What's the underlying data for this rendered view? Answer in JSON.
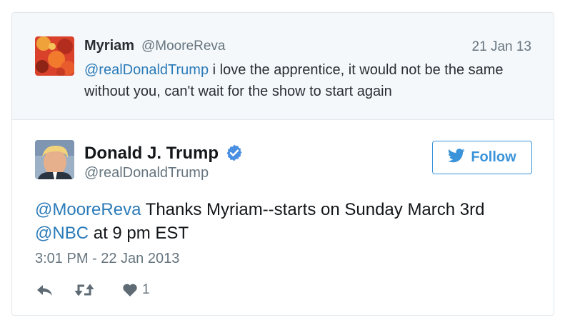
{
  "parent_tweet": {
    "name": "Myriam",
    "handle": "@MooreReva",
    "date": "21 Jan 13",
    "mention": "@realDonaldTrump",
    "text": " i love the apprentice, it would not be the same without you, can't wait for the show to start again"
  },
  "tweet": {
    "name": "Donald J. Trump",
    "handle": "@realDonaldTrump",
    "mention1": "@MooreReva",
    "text1": " Thanks Myriam--starts on Sunday March 3rd",
    "mention2": "@NBC",
    "text2": " at 9 pm EST",
    "timestamp": "3:01 PM - 22 Jan 2013",
    "like_count": "1"
  },
  "follow_button": {
    "label": "Follow",
    "icon": "twitter-bird-icon"
  },
  "icons": {
    "verified": "verified-badge-icon",
    "reply": "reply-icon",
    "retweet": "retweet-icon",
    "like": "heart-icon"
  },
  "colors": {
    "link": "#2b7bb9",
    "follow_blue": "#3b94d9",
    "verified_blue": "#4a90e2",
    "muted": "#66757f",
    "action_gray": "#5e6b75",
    "parent_bg": "#f5f8fa",
    "border": "#e1e8ed"
  }
}
